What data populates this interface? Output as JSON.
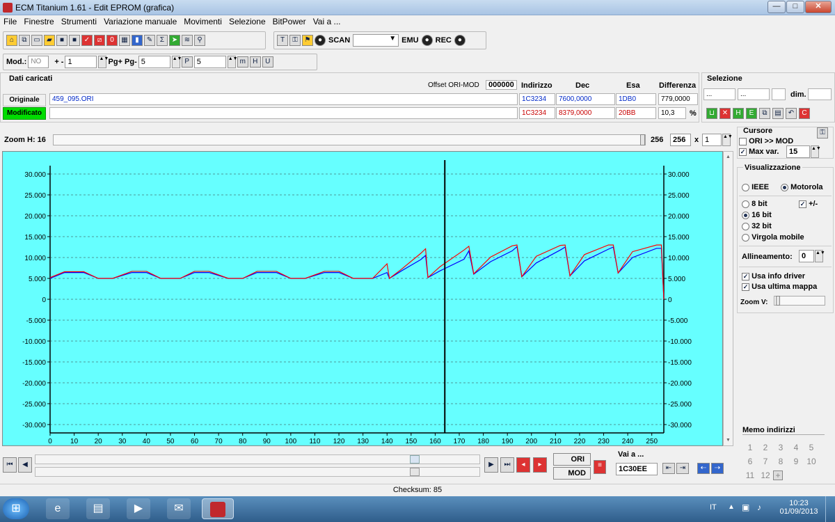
{
  "window": {
    "title": "ECM Titanium 1.61 - Edit EPROM (grafica)",
    "minimize": "—",
    "maximize": "□",
    "close": "✕"
  },
  "menu": [
    "File",
    "Finestre",
    "Strumenti",
    "Variazione manuale",
    "Movimenti",
    "Selezione",
    "BitPower",
    "Vai a ..."
  ],
  "toolbar1": {
    "scan_label": "SCAN",
    "emu_label": "EMU",
    "rec_label": "REC"
  },
  "toolbar2": {
    "mod_label": "Mod.:",
    "mod_value": "NO",
    "plusminus_label": "+ -",
    "plusminus_value": "1",
    "pg_label": "Pg+ Pg-",
    "pg_value": "5",
    "p_value": "5"
  },
  "loaded": {
    "title": "Dati caricati",
    "offset_label": "Offset ORI-MOD",
    "offset_value": "000000",
    "headers": {
      "address": "Indirizzo",
      "dec": "Dec",
      "hex": "Esa",
      "diff": "Differenza"
    },
    "original": {
      "label": "Originale",
      "file": "459_095.ORI",
      "address": "1C3234",
      "dec": "7600,0000",
      "hex": "1DB0",
      "diff": "779,0000"
    },
    "modified": {
      "label": "Modificato",
      "file": "",
      "address": "1C3234",
      "dec": "8379,0000",
      "hex": "20BB",
      "diff": "10,3",
      "pct": "%"
    }
  },
  "selection": {
    "title": "Selezione",
    "field1": "...",
    "field2": "...",
    "dim_label": "dim."
  },
  "zoom": {
    "label": "Zoom H: 16",
    "value1": "256",
    "value2": "256",
    "x_label": "x",
    "mult": "1"
  },
  "cursor_panel": {
    "title": "Cursore",
    "ori_mod": "ORI >> MOD",
    "max_var": "Max var.",
    "max_var_value": "15"
  },
  "display_panel": {
    "title": "Visualizzazione",
    "ieee": "IEEE",
    "motorola": "Motorola",
    "bit8": "8 bit",
    "plusminus": "+/-",
    "bit16": "16 bit",
    "bit32": "32 bit",
    "float": "Virgola mobile",
    "align_label": "Allineamento:",
    "align_value": "0",
    "use_driver": "Usa info driver",
    "use_last_map": "Usa ultima mappa",
    "zoom_v": "Zoom V:"
  },
  "memo": {
    "title": "Memo indirizzi",
    "numbers": [
      "1",
      "2",
      "3",
      "4",
      "5",
      "6",
      "7",
      "8",
      "9",
      "10",
      "11",
      "12"
    ]
  },
  "bottom": {
    "ori_label": "ORI",
    "mod_label": "MOD",
    "goto_label": "Vai a ...",
    "goto_value": "1C30EE"
  },
  "status": {
    "checksum": "Checksum: 85"
  },
  "tray": {
    "lang": "IT",
    "time": "10:23",
    "date": "01/09/2013"
  },
  "colors": {
    "plot_bg": "#66ffff",
    "original_series": "#0000ff",
    "modified_series": "#ff0000",
    "modified_label_bg": "#00dd00"
  },
  "chart_data": {
    "type": "line",
    "x_ticks": [
      0,
      10,
      20,
      30,
      40,
      50,
      60,
      70,
      80,
      90,
      100,
      110,
      120,
      130,
      140,
      150,
      160,
      170,
      180,
      190,
      200,
      210,
      220,
      230,
      240,
      250
    ],
    "y_ticks": [
      "30.000",
      "25.000",
      "20.000",
      "15.000",
      "10.000",
      "5.000",
      "0",
      "-5.000",
      "-10.000",
      "-15.000",
      "-20.000",
      "-25.000",
      "-30.000"
    ],
    "xlim": [
      0,
      255
    ],
    "ylim": [
      -32000,
      32000
    ],
    "cursor_x": 164,
    "grid": true,
    "series": [
      {
        "color": "#0000ff",
        "x": [
          0,
          6,
          14,
          20,
          26,
          34,
          40,
          46,
          54,
          60,
          66,
          74,
          80,
          86,
          94,
          100,
          106,
          114,
          120,
          126,
          134,
          140,
          141,
          146,
          154,
          156,
          157,
          162,
          172,
          174,
          176,
          183,
          192,
          194,
          196,
          202,
          212,
          214,
          216,
          222,
          232,
          234,
          236,
          242,
          252,
          254,
          255
        ],
        "y": [
          5000,
          6400,
          6400,
          5000,
          5000,
          6400,
          6400,
          5000,
          5000,
          6400,
          6400,
          5000,
          5000,
          6400,
          6400,
          5000,
          5000,
          6400,
          6400,
          5000,
          5000,
          6400,
          5000,
          6800,
          9500,
          10500,
          5200,
          6800,
          9600,
          11600,
          6000,
          9000,
          11600,
          12600,
          5400,
          8700,
          11800,
          12500,
          5600,
          9200,
          12000,
          12500,
          6300,
          10000,
          12200,
          12200,
          0
        ]
      },
      {
        "color": "#ff0000",
        "x": [
          0,
          6,
          14,
          20,
          26,
          34,
          40,
          46,
          54,
          60,
          66,
          74,
          80,
          86,
          94,
          100,
          106,
          114,
          120,
          126,
          134,
          140,
          141,
          146,
          154,
          156,
          157,
          162,
          172,
          174,
          176,
          183,
          192,
          194,
          196,
          202,
          212,
          214,
          216,
          222,
          232,
          234,
          236,
          242,
          252,
          254,
          255
        ],
        "y": [
          5200,
          6600,
          6600,
          5000,
          5000,
          6700,
          6700,
          5000,
          5000,
          6700,
          6700,
          5000,
          5000,
          6700,
          6700,
          5000,
          5000,
          6700,
          6700,
          5000,
          5000,
          8500,
          5000,
          7200,
          11000,
          12100,
          5200,
          7800,
          11800,
          12700,
          6100,
          10100,
          12800,
          13000,
          5400,
          10300,
          12900,
          13000,
          5600,
          10700,
          13000,
          13000,
          6300,
          11400,
          13000,
          13000,
          0
        ]
      }
    ]
  }
}
